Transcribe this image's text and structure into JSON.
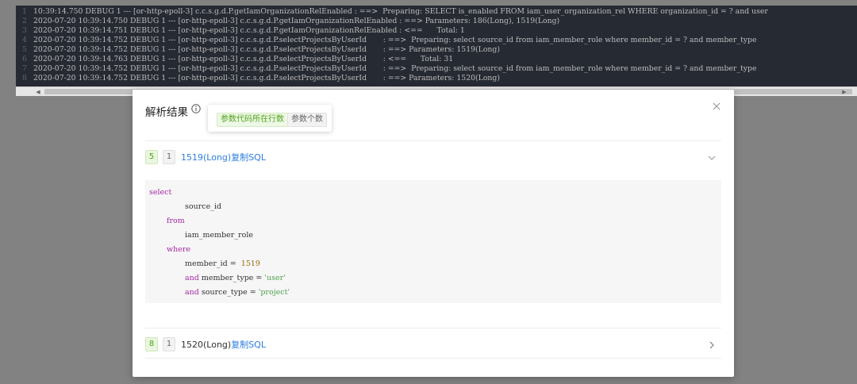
{
  "log": {
    "lines": [
      {
        "num": "1",
        "text": "10:39:14.750 DEBUG 1 --- [or-http-epoll-3] c.c.s.g.d.P.getIamOrganizationRelEnabled : ==>  Preparing: SELECT is_enabled FROM iam_user_organization_rel WHERE organization_id = ? and user"
      },
      {
        "num": "2",
        "text": "2020-07-20 10:39:14.750 DEBUG 1 --- [or-http-epoll-3] c.c.s.g.d.P.getIamOrganizationRelEnabled : ==> Parameters: 186(Long), 1519(Long)"
      },
      {
        "num": "3",
        "text": "2020-07-20 10:39:14.751 DEBUG 1 --- [or-http-epoll-3] c.c.s.g.d.P.getIamOrganizationRelEnabled : <==      Total: 1"
      },
      {
        "num": "4",
        "text": "2020-07-20 10:39:14.752 DEBUG 1 --- [or-http-epoll-3] c.c.s.g.d.P.selectProjectsByUserId       : ==>  Preparing: select source_id from iam_member_role where member_id = ? and member_type"
      },
      {
        "num": "5",
        "text": "2020-07-20 10:39:14.752 DEBUG 1 --- [or-http-epoll-3] c.c.s.g.d.P.selectProjectsByUserId       : ==> Parameters: 1519(Long)"
      },
      {
        "num": "6",
        "text": "2020-07-20 10:39:14.763 DEBUG 1 --- [or-http-epoll-3] c.c.s.g.d.P.selectProjectsByUserId       : <==      Total: 31"
      },
      {
        "num": "7",
        "text": "2020-07-20 10:39:14.752 DEBUG 1 --- [or-http-epoll-3] c.c.s.g.d.P.selectProjectsByUserId       : ==>  Preparing: select source_id from iam_member_role where member_id = ? and member_type"
      },
      {
        "num": "8",
        "text": "2020-07-20 10:39:14.752 DEBUG 1 --- [or-http-epoll-3] c.c.s.g.d.P.selectProjectsByUserId       : ==> Parameters: 1520(Long)"
      }
    ]
  },
  "modal": {
    "title": "解析结果",
    "tooltip": {
      "tag_line_no": "参数代码所在行数",
      "tag_param_count": "参数个数"
    },
    "results": [
      {
        "line_no": "5",
        "param_count": "1",
        "params": "1519(Long)",
        "copy_label": "复制SQL",
        "expanded": true
      },
      {
        "line_no": "8",
        "param_count": "1",
        "params": "1520(Long)",
        "copy_label": "复制SQL",
        "expanded": false
      }
    ],
    "sql": {
      "select": "select",
      "source_id": "source_id",
      "from": "from",
      "table": "iam_member_role",
      "where": "where",
      "cond1_lhs": "member_id = ",
      "cond1_val": "1519",
      "and1": "and",
      "cond2_lhs": " member_type = ",
      "cond2_val": "'user'",
      "and2": "and",
      "cond3_lhs": " source_type = ",
      "cond3_val": "'project'"
    }
  },
  "colors": {
    "overlay": "#828282",
    "console_bg": "#262a33",
    "accent_blue": "#2b7de0",
    "tag_green": "#52a41a",
    "sql_keyword": "#a626a4"
  }
}
